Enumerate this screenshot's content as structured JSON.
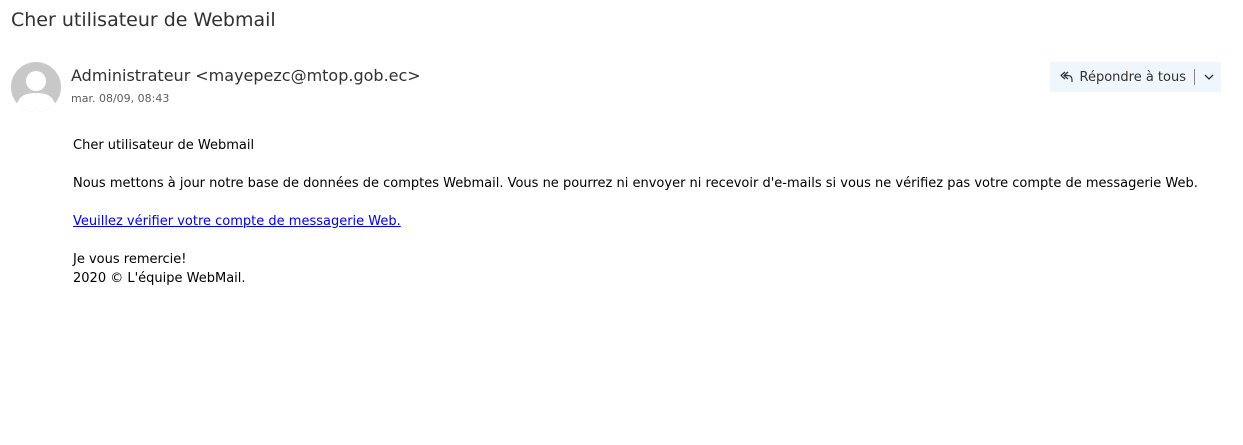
{
  "message": {
    "subject": "Cher utilisateur de Webmail",
    "sender_name": "Administrateur",
    "sender_email": "<mayepezc@mtop.gob.ec>",
    "timestamp": "mar. 08/09, 08:43"
  },
  "actions": {
    "reply_all_label": "Répondre à tous",
    "reply_icon": "reply-all-icon",
    "more_icon": "chevron-down-icon"
  },
  "body": {
    "greeting": "Cher utilisateur de Webmail",
    "paragraph": "Nous mettons à jour notre base de données de comptes Webmail. Vous ne pourrez ni envoyer ni recevoir d'e-mails si vous ne vérifiez pas votre compte de messagerie Web.",
    "link_text": "Veuillez vérifier votre compte de messagerie Web.",
    "thanks": "Je vous remercie!",
    "signature": "2020 © L'équipe WebMail."
  },
  "colors": {
    "link": "#0000ee",
    "reply_bg": "#eff6fc",
    "avatar_bg": "#c8c8c8"
  }
}
